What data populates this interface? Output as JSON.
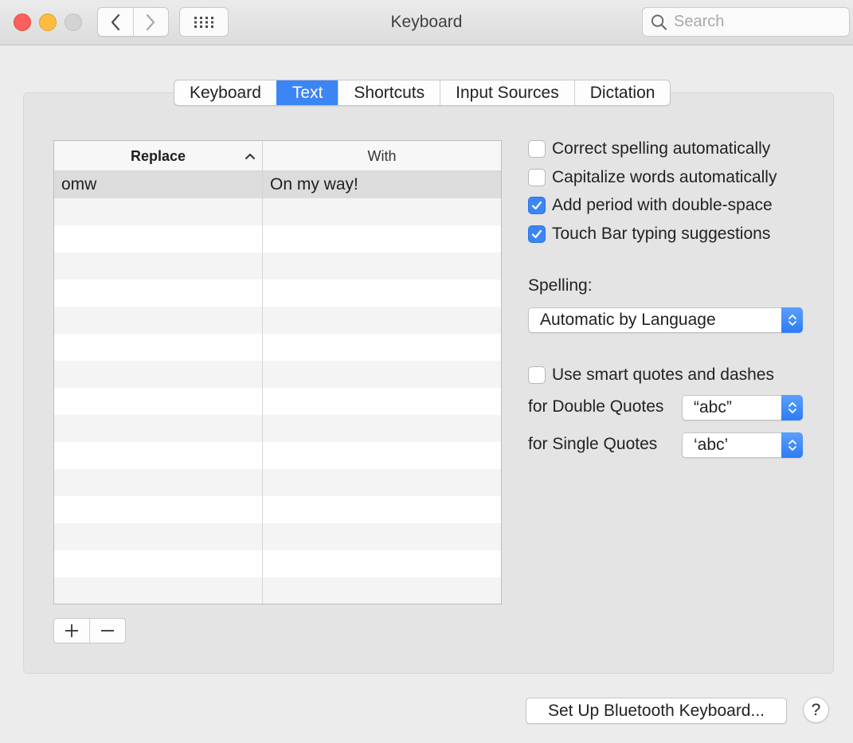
{
  "window": {
    "title": "Keyboard"
  },
  "search": {
    "placeholder": "Search",
    "value": ""
  },
  "tabs": [
    {
      "label": "Keyboard",
      "active": false
    },
    {
      "label": "Text",
      "active": true
    },
    {
      "label": "Shortcuts",
      "active": false
    },
    {
      "label": "Input Sources",
      "active": false
    },
    {
      "label": "Dictation",
      "active": false
    }
  ],
  "table": {
    "columns": [
      "Replace",
      "With"
    ],
    "sort_column": "Replace",
    "rows": [
      {
        "replace": "omw",
        "with": "On my way!",
        "selected": true
      }
    ]
  },
  "options": {
    "correct_spelling": {
      "label": "Correct spelling automatically",
      "checked": false
    },
    "capitalize_words": {
      "label": "Capitalize words automatically",
      "checked": false
    },
    "add_period": {
      "label": "Add period with double-space",
      "checked": true
    },
    "touch_bar": {
      "label": "Touch Bar typing suggestions",
      "checked": true
    },
    "smart_quotes": {
      "label": "Use smart quotes and dashes",
      "checked": false
    }
  },
  "spelling": {
    "label": "Spelling:",
    "value": "Automatic by Language"
  },
  "double_quotes": {
    "label": "for Double Quotes",
    "value": "“abc”"
  },
  "single_quotes": {
    "label": "for Single Quotes",
    "value": "‘abc’"
  },
  "footer": {
    "bluetooth_button": "Set Up Bluetooth Keyboard...",
    "help": "?"
  },
  "colors": {
    "accent": "#3b85f5",
    "close": "#fc605c",
    "minimize": "#fdbc40"
  }
}
